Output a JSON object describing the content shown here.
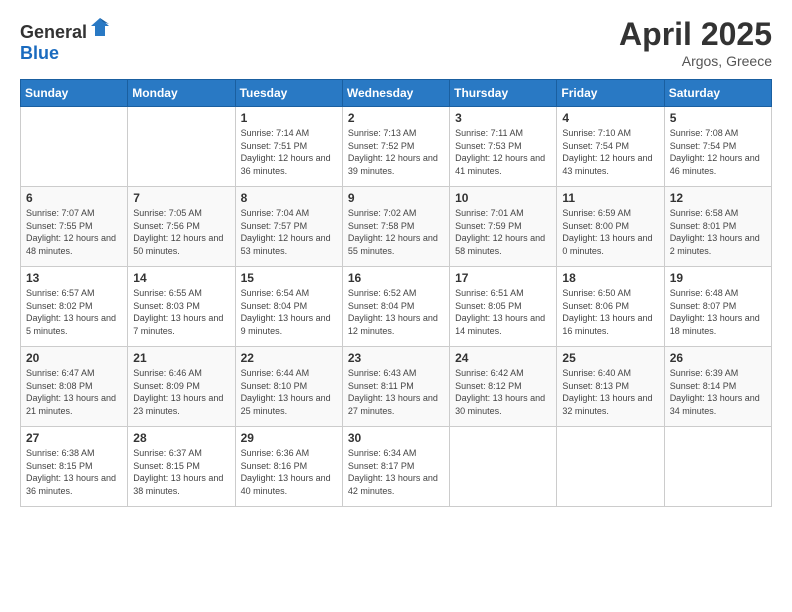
{
  "header": {
    "logo_general": "General",
    "logo_blue": "Blue",
    "title": "April 2025",
    "subtitle": "Argos, Greece"
  },
  "weekdays": [
    "Sunday",
    "Monday",
    "Tuesday",
    "Wednesday",
    "Thursday",
    "Friday",
    "Saturday"
  ],
  "weeks": [
    [
      {
        "day": "",
        "info": ""
      },
      {
        "day": "",
        "info": ""
      },
      {
        "day": "1",
        "info": "Sunrise: 7:14 AM\nSunset: 7:51 PM\nDaylight: 12 hours and 36 minutes."
      },
      {
        "day": "2",
        "info": "Sunrise: 7:13 AM\nSunset: 7:52 PM\nDaylight: 12 hours and 39 minutes."
      },
      {
        "day": "3",
        "info": "Sunrise: 7:11 AM\nSunset: 7:53 PM\nDaylight: 12 hours and 41 minutes."
      },
      {
        "day": "4",
        "info": "Sunrise: 7:10 AM\nSunset: 7:54 PM\nDaylight: 12 hours and 43 minutes."
      },
      {
        "day": "5",
        "info": "Sunrise: 7:08 AM\nSunset: 7:54 PM\nDaylight: 12 hours and 46 minutes."
      }
    ],
    [
      {
        "day": "6",
        "info": "Sunrise: 7:07 AM\nSunset: 7:55 PM\nDaylight: 12 hours and 48 minutes."
      },
      {
        "day": "7",
        "info": "Sunrise: 7:05 AM\nSunset: 7:56 PM\nDaylight: 12 hours and 50 minutes."
      },
      {
        "day": "8",
        "info": "Sunrise: 7:04 AM\nSunset: 7:57 PM\nDaylight: 12 hours and 53 minutes."
      },
      {
        "day": "9",
        "info": "Sunrise: 7:02 AM\nSunset: 7:58 PM\nDaylight: 12 hours and 55 minutes."
      },
      {
        "day": "10",
        "info": "Sunrise: 7:01 AM\nSunset: 7:59 PM\nDaylight: 12 hours and 58 minutes."
      },
      {
        "day": "11",
        "info": "Sunrise: 6:59 AM\nSunset: 8:00 PM\nDaylight: 13 hours and 0 minutes."
      },
      {
        "day": "12",
        "info": "Sunrise: 6:58 AM\nSunset: 8:01 PM\nDaylight: 13 hours and 2 minutes."
      }
    ],
    [
      {
        "day": "13",
        "info": "Sunrise: 6:57 AM\nSunset: 8:02 PM\nDaylight: 13 hours and 5 minutes."
      },
      {
        "day": "14",
        "info": "Sunrise: 6:55 AM\nSunset: 8:03 PM\nDaylight: 13 hours and 7 minutes."
      },
      {
        "day": "15",
        "info": "Sunrise: 6:54 AM\nSunset: 8:04 PM\nDaylight: 13 hours and 9 minutes."
      },
      {
        "day": "16",
        "info": "Sunrise: 6:52 AM\nSunset: 8:04 PM\nDaylight: 13 hours and 12 minutes."
      },
      {
        "day": "17",
        "info": "Sunrise: 6:51 AM\nSunset: 8:05 PM\nDaylight: 13 hours and 14 minutes."
      },
      {
        "day": "18",
        "info": "Sunrise: 6:50 AM\nSunset: 8:06 PM\nDaylight: 13 hours and 16 minutes."
      },
      {
        "day": "19",
        "info": "Sunrise: 6:48 AM\nSunset: 8:07 PM\nDaylight: 13 hours and 18 minutes."
      }
    ],
    [
      {
        "day": "20",
        "info": "Sunrise: 6:47 AM\nSunset: 8:08 PM\nDaylight: 13 hours and 21 minutes."
      },
      {
        "day": "21",
        "info": "Sunrise: 6:46 AM\nSunset: 8:09 PM\nDaylight: 13 hours and 23 minutes."
      },
      {
        "day": "22",
        "info": "Sunrise: 6:44 AM\nSunset: 8:10 PM\nDaylight: 13 hours and 25 minutes."
      },
      {
        "day": "23",
        "info": "Sunrise: 6:43 AM\nSunset: 8:11 PM\nDaylight: 13 hours and 27 minutes."
      },
      {
        "day": "24",
        "info": "Sunrise: 6:42 AM\nSunset: 8:12 PM\nDaylight: 13 hours and 30 minutes."
      },
      {
        "day": "25",
        "info": "Sunrise: 6:40 AM\nSunset: 8:13 PM\nDaylight: 13 hours and 32 minutes."
      },
      {
        "day": "26",
        "info": "Sunrise: 6:39 AM\nSunset: 8:14 PM\nDaylight: 13 hours and 34 minutes."
      }
    ],
    [
      {
        "day": "27",
        "info": "Sunrise: 6:38 AM\nSunset: 8:15 PM\nDaylight: 13 hours and 36 minutes."
      },
      {
        "day": "28",
        "info": "Sunrise: 6:37 AM\nSunset: 8:15 PM\nDaylight: 13 hours and 38 minutes."
      },
      {
        "day": "29",
        "info": "Sunrise: 6:36 AM\nSunset: 8:16 PM\nDaylight: 13 hours and 40 minutes."
      },
      {
        "day": "30",
        "info": "Sunrise: 6:34 AM\nSunset: 8:17 PM\nDaylight: 13 hours and 42 minutes."
      },
      {
        "day": "",
        "info": ""
      },
      {
        "day": "",
        "info": ""
      },
      {
        "day": "",
        "info": ""
      }
    ]
  ]
}
